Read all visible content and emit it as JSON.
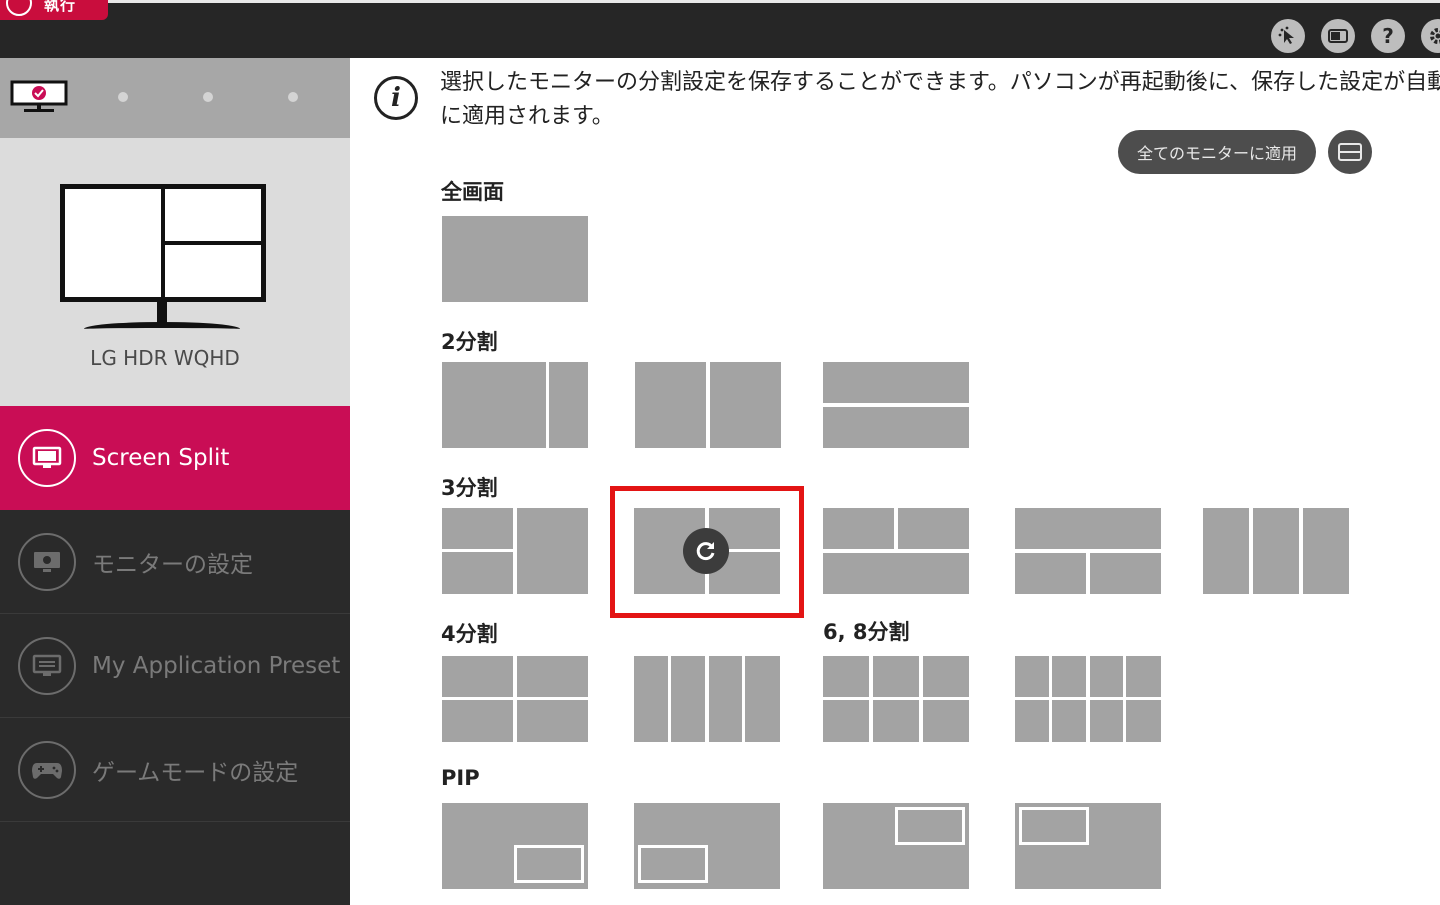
{
  "topbar": {
    "logo_text": "執行",
    "icons": [
      "cursor-icon",
      "display-icon",
      "help-icon",
      "settings-icon"
    ],
    "help_glyph": "?",
    "accent": "#c90d3d"
  },
  "sidebar": {
    "monitor_name": "LG HDR WQHD",
    "nav": [
      {
        "label": "Screen Split",
        "icon": "monitor-icon",
        "active": true
      },
      {
        "label": "モニターの設定",
        "icon": "monitor-settings-icon",
        "active": false
      },
      {
        "label": "My Application Preset",
        "icon": "preset-icon",
        "active": false
      },
      {
        "label": "ゲームモードの設定",
        "icon": "gamepad-icon",
        "active": false
      }
    ]
  },
  "main": {
    "info_line1": "選択したモニターの分割設定を保存することができます。パソコンが再起動後に、保存した設定が自動的",
    "info_line2": "に適用されます。",
    "apply_all_label": "全てのモニターに適用",
    "sections": {
      "full": "全画面",
      "split2": "2分割",
      "split3": "3分割",
      "split4": "4分割",
      "split68": "6, 8分割",
      "pip": "PIP"
    },
    "selected_layout": "3分割 layout 2"
  }
}
